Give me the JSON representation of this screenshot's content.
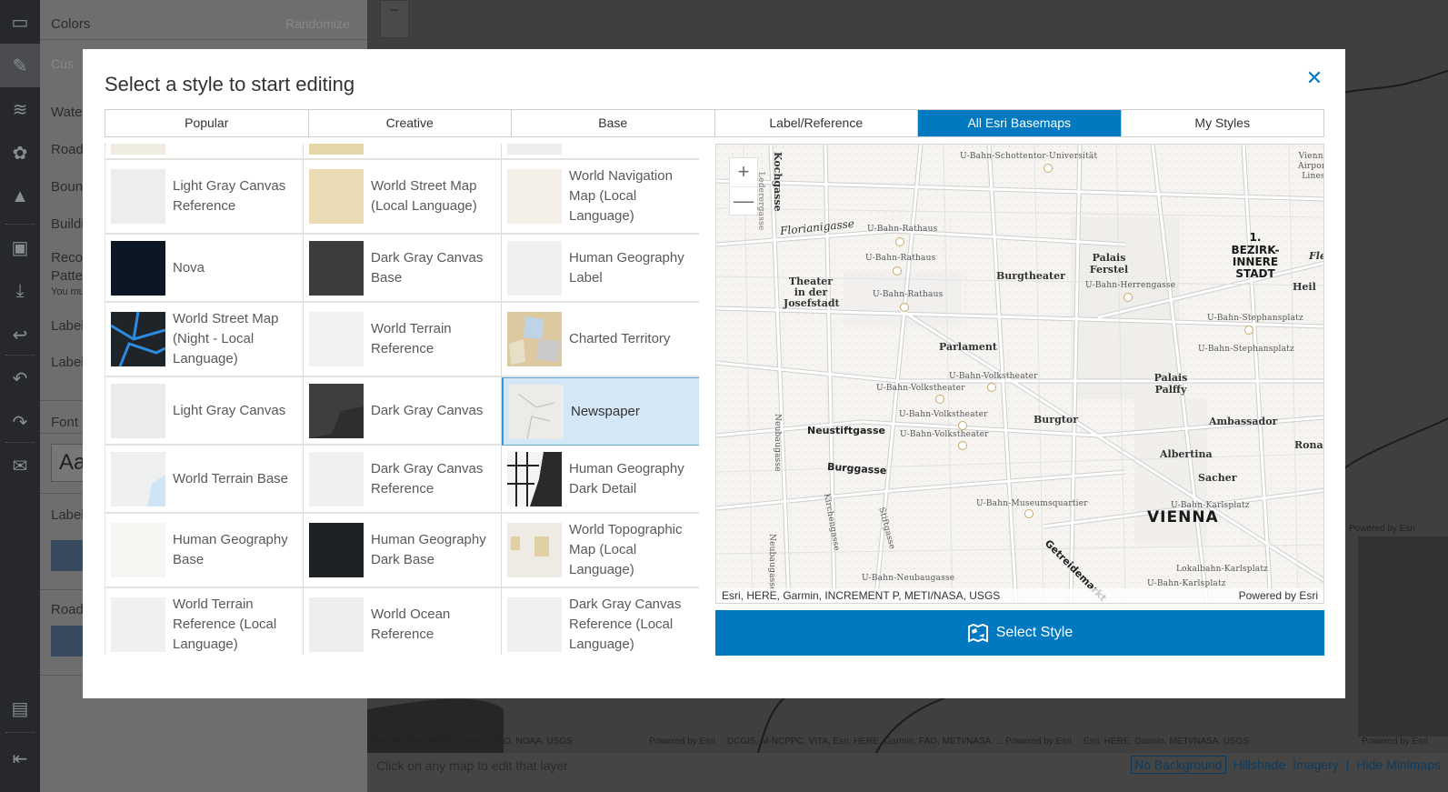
{
  "background_app": {
    "rail_icons": [
      "folder-icon",
      "pencil-icon",
      "layers-icon",
      "palette-icon",
      "map-style-icon",
      "save-icon",
      "download-icon",
      "share-icon",
      "undo-icon",
      "redo-icon",
      "mail-icon",
      "print-icon",
      "exit-icon"
    ],
    "panel": {
      "colors_heading": "Colors",
      "randomize_label": "Randomize",
      "custom_input_placeholder": "Cus",
      "rows": [
        "Water",
        "Roads",
        "Bound",
        "Buildi",
        "Recol",
        "Patter"
      ],
      "note": "You mu",
      "label_rows": [
        "Label",
        "Label"
      ],
      "font_heading": "Font",
      "font_sample": "Aa",
      "labels_heading": "Label",
      "roads_heading": "Road"
    },
    "minimap_attributions": [
      {
        "source": "Esri UK, Esri, HERE, Garmin, FAO, NOAA, USGS",
        "powered": "Powered by Esri"
      },
      {
        "source": "DCGIS, M-NCPPC, VITA, Esri, HERE, Garmin, FAO, METI/NASA, ...",
        "powered": "Powered by Esri"
      },
      {
        "source": "Esri, HERE, Garmin, METI/NASA, USGS",
        "powered": "Powered by Esri"
      }
    ],
    "right_powered": "Powered by Esri",
    "bottom_hint": "Click on any map to edit that layer",
    "background_options": [
      "No Background",
      "Hillshade",
      "Imagery"
    ],
    "background_selected": "No Background",
    "hide_minimaps": "Hide Minimaps"
  },
  "modal": {
    "title": "Select a style to start editing",
    "close_icon": "close-icon",
    "tabs": [
      {
        "label": "Popular",
        "active": false
      },
      {
        "label": "Creative",
        "active": false
      },
      {
        "label": "Base",
        "active": false
      },
      {
        "label": "Label/Reference",
        "active": false
      },
      {
        "label": "All Esri Basemaps",
        "active": true
      },
      {
        "label": "My Styles",
        "active": false
      }
    ],
    "styles": [
      {
        "label": "",
        "partial": true
      },
      {
        "label": "",
        "partial": true
      },
      {
        "label": "",
        "partial": true
      },
      {
        "label": "Light Gray Canvas Reference"
      },
      {
        "label": "World Street Map (Local Language)"
      },
      {
        "label": "World Navigation Map (Local Language)"
      },
      {
        "label": "Nova"
      },
      {
        "label": "Dark Gray Canvas Base"
      },
      {
        "label": "Human Geography Label"
      },
      {
        "label": "World Street Map (Night - Local Language)"
      },
      {
        "label": "World Terrain Reference"
      },
      {
        "label": "Charted Territory"
      },
      {
        "label": "Light Gray Canvas"
      },
      {
        "label": "Dark Gray Canvas"
      },
      {
        "label": "Newspaper",
        "selected": true
      },
      {
        "label": "World Terrain Base"
      },
      {
        "label": "Dark Gray Canvas Reference"
      },
      {
        "label": "Human Geography Dark Detail"
      },
      {
        "label": "Human Geography Base"
      },
      {
        "label": "Human Geography Dark Base"
      },
      {
        "label": "World Topographic Map (Local Language)"
      },
      {
        "label": "World Terrain Reference (Local Language)"
      },
      {
        "label": "World Ocean Reference"
      },
      {
        "label": "Dark Gray Canvas Reference (Local Language)"
      }
    ],
    "preview": {
      "zoom_in": "+",
      "zoom_out": "—",
      "labels": {
        "kochgasse": "Kochgasse",
        "laudongasse": "Lederergasse",
        "florianigasse": "Florianigasse",
        "ubahn_rathaus": "U-Bahn-Rathaus",
        "ubahn_schottentor": "U-Bahn-Schottentor-Universität",
        "theater": "Theater in der Josefstadt",
        "burgtheater": "Burgtheater",
        "palais_ferstel": "Palais Ferstel",
        "ubahn_herrengasse": "U-Bahn-Herrengasse",
        "district_num": "1.",
        "district_name": "BEZIRK-INNERE STADT",
        "vienna_airport": "Vienna Airport Lines",
        "parlament": "Parlament",
        "ubahn_stephansplatz": "U-Bahn-Stephansplatz",
        "ubahn_volkstheater": "U-Bahn-Volkstheater",
        "palais_palffy": "Palais Palffy",
        "burgtor": "Burgtor",
        "ambassador": "Ambassador",
        "neubaugasse": "Neubaugasse",
        "neustiftgasse": "Neustiftgasse",
        "burggasse": "Burggasse",
        "albertina": "Albertina",
        "sacher": "Sacher",
        "kirchengasse": "Kirchengasse",
        "stiftgasse": "Stiftgasse",
        "ubahn_museumsquartier": "U-Bahn-Museumsquartier",
        "ubahn_karlsplatz": "U-Bahn-Karlsplatz",
        "vienna": "VIENNA",
        "getreidemarkt": "Getreidemarkt",
        "lokalbahn_karlsplatz": "Lokalbahn-Karlsplatz",
        "ubahn_neubaugasse": "U-Bahn-Neubaugasse",
        "heil": "Heil",
        "ronac": "Ronac",
        "fle": "Fle"
      },
      "attribution": "Esri, HERE, Garmin, INCREMENT P, METI/NASA, USGS",
      "powered": "Powered by Esri"
    },
    "select_button": "Select Style"
  },
  "colors": {
    "accent": "#0079c1",
    "selected_bg": "#d3e7f6",
    "selected_border": "#5da8dc"
  }
}
